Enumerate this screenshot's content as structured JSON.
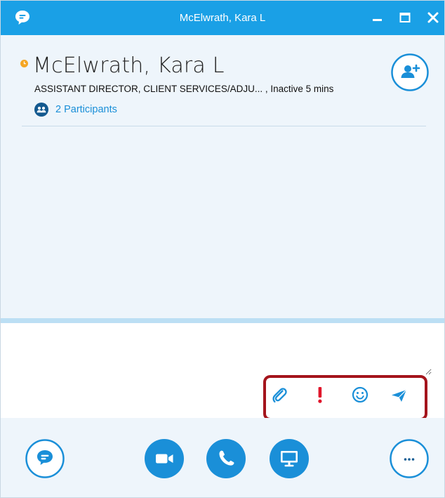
{
  "window": {
    "title": "McElwrath, Kara L",
    "controls": {
      "minimize": "minimize-icon",
      "maximize": "maximize-icon",
      "close": "close-icon"
    }
  },
  "header": {
    "contact_name": "McElwrath, Kara L",
    "subtitle": "ASSISTANT DIRECTOR, CLIENT SERVICES/ADJU... , Inactive 5 mins",
    "status": "away",
    "status_color": "#f5a623",
    "participants_label": "2 Participants",
    "add_person_icon": "add-person-icon"
  },
  "compose": {
    "placeholder": "",
    "tools": [
      {
        "name": "attach-icon",
        "label": "Attach"
      },
      {
        "name": "importance-icon",
        "label": "High importance"
      },
      {
        "name": "emoticon-icon",
        "label": "Emoticons"
      },
      {
        "name": "send-icon",
        "label": "Send"
      }
    ]
  },
  "toolbar": {
    "buttons": [
      "im-button",
      "video-button",
      "call-button",
      "present-button",
      "more-options-button"
    ]
  },
  "colors": {
    "accent": "#1aa0e6",
    "importance": "#e0162b",
    "highlight": "#a4141c",
    "background": "#eef5fb"
  }
}
